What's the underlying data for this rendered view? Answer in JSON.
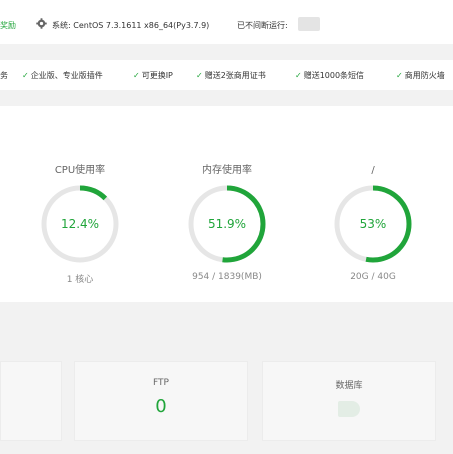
{
  "topbar": {
    "reward_label": "奖励",
    "system_label": "系统:",
    "system_value": "CentOS 7.3.1611 x86_64(Py3.7.9)",
    "runtime_label": "已不间断运行:"
  },
  "features": [
    {
      "label": "务"
    },
    {
      "label": "企业版、专业版插件"
    },
    {
      "label": "可更换IP"
    },
    {
      "label": "赠送2张商用证书"
    },
    {
      "label": "赠送1000条短信"
    },
    {
      "label": "商用防火墙"
    }
  ],
  "gauges": [
    {
      "title": "CPU使用率",
      "percent": 12.4,
      "percent_label": "12.4%",
      "sub": "1 核心"
    },
    {
      "title": "内存使用率",
      "percent": 51.9,
      "percent_label": "51.9%",
      "sub": "954 / 1839(MB)"
    },
    {
      "title": "/",
      "percent": 53,
      "percent_label": "53%",
      "sub": "20G / 40G"
    }
  ],
  "cards": [
    {
      "label": "",
      "value": ""
    },
    {
      "label": "FTP",
      "value": "0"
    },
    {
      "label": "数据库",
      "value": ""
    }
  ],
  "colors": {
    "accent": "#20a53a",
    "ring_track": "#e6e6e6"
  },
  "icons": {
    "system": "gear-icon",
    "check": "check-icon"
  }
}
